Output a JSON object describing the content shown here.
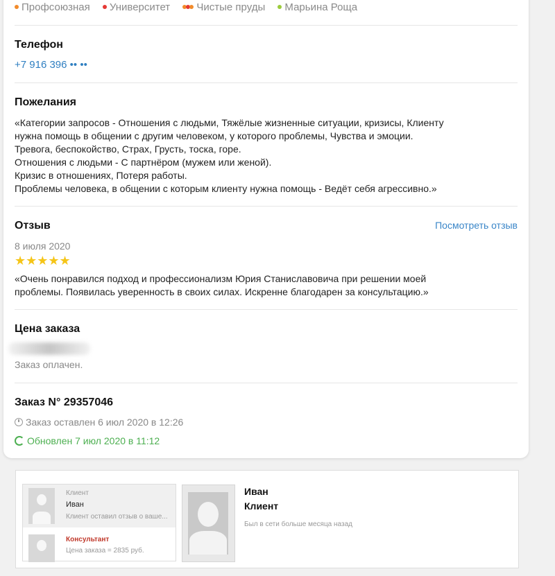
{
  "metro": {
    "stations": [
      {
        "name": "Профсоюзная",
        "color": "#f28b2b"
      },
      {
        "name": "Университет",
        "color": "#e53935"
      },
      {
        "name": "Чистые пруды",
        "colors": [
          "#f28b2b",
          "#e53935",
          "#f28b2b"
        ]
      },
      {
        "name": "Марьина Роща",
        "color": "#9ccc3c"
      }
    ]
  },
  "phone": {
    "label": "Телефон",
    "value": "+7 916 396 •• ••"
  },
  "wishes": {
    "label": "Пожелания",
    "lines": [
      "«Категории запросов - Отношения с людьми, Тяжёлые жизненные ситуации, кризисы, Клиенту",
      "нужна помощь в общении с другим человеком, у которого проблемы, Чувства и эмоции.",
      "Тревога, беспокойство, Страх, Грусть, тоска, горе.",
      "Отношения с людьми - С партнёром (мужем или женой).",
      "Кризис в отношениях, Потеря работы.",
      "Проблемы человека, в общении с которым клиенту нужна помощь - Ведёт себя агрессивно.»"
    ]
  },
  "review": {
    "label": "Отзыв",
    "link": "Посмотреть отзыв",
    "date": "8 июля 2020",
    "rating": 5,
    "stars": "★★★★★",
    "text_lines": [
      "«Очень понравился подход и профессионализм Юрия Станиславовича при решении моей",
      "проблемы. Появилась уверенность в своих силах. Искренне благодарен за консультацию.»"
    ]
  },
  "price": {
    "label": "Цена заказа",
    "status": "Заказ оплачен."
  },
  "order": {
    "title": "Заказ N° 29357046",
    "created": "Заказ оставлен 6 июл 2020 в 12:26",
    "updated": "Обновлен 7 июл 2020 в 11:12",
    "updated_color": "#4caf50"
  },
  "chat": {
    "items": [
      {
        "role": "Клиент",
        "name": "Иван",
        "preview": "Клиент оставил отзыв о ваше..."
      },
      {
        "role": "Консультант",
        "preview": "Цена заказа = 2835 руб."
      }
    ],
    "profile": {
      "name": "Иван",
      "role": "Клиент",
      "last_seen": "Был в сети больше месяца назад"
    }
  }
}
